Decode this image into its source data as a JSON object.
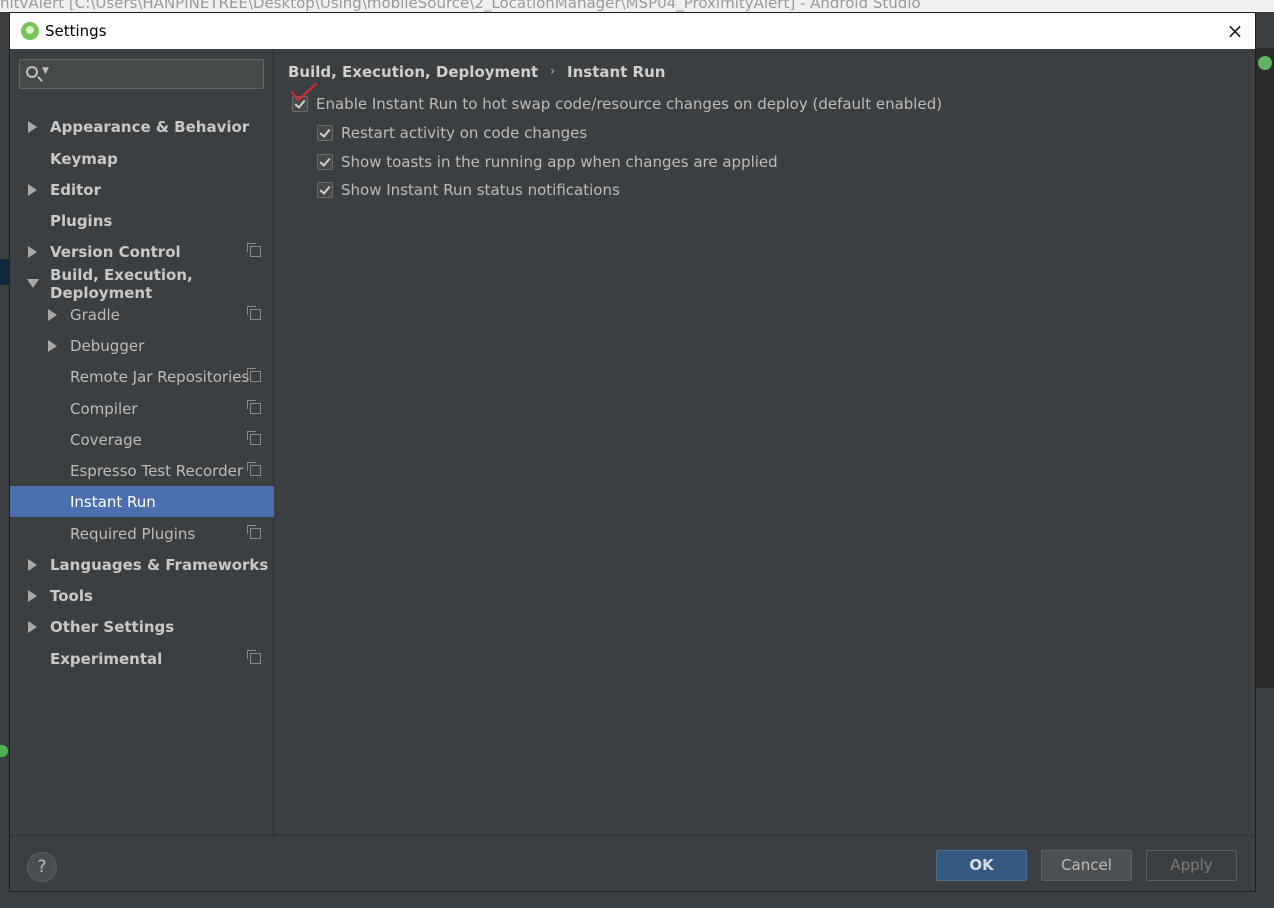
{
  "background": {
    "window_title": "nitvAlert [C:\\Users\\HANPINETREE\\Desktop\\Using\\mobileSource\\2_LocationManager\\MSP04_ProximityAlert] - Android Studio"
  },
  "dialog": {
    "title": "Settings",
    "close_icon": "×"
  },
  "search": {
    "placeholder": ""
  },
  "sidebar": {
    "items": [
      {
        "label": "Appearance & Behavior"
      },
      {
        "label": "Keymap"
      },
      {
        "label": "Editor"
      },
      {
        "label": "Plugins"
      },
      {
        "label": "Version Control"
      },
      {
        "label": "Build, Execution, Deployment"
      },
      {
        "label": "Gradle"
      },
      {
        "label": "Debugger"
      },
      {
        "label": "Remote Jar Repositories"
      },
      {
        "label": "Compiler"
      },
      {
        "label": "Coverage"
      },
      {
        "label": "Espresso Test Recorder"
      },
      {
        "label": "Instant Run"
      },
      {
        "label": "Required Plugins"
      },
      {
        "label": "Languages & Frameworks"
      },
      {
        "label": "Tools"
      },
      {
        "label": "Other Settings"
      },
      {
        "label": "Experimental"
      }
    ]
  },
  "content": {
    "breadcrumb": {
      "parent": "Build, Execution, Deployment",
      "separator": "›",
      "current": "Instant Run"
    },
    "options": [
      {
        "label": "Enable Instant Run to hot swap code/resource changes on deploy (default enabled)",
        "checked": true
      },
      {
        "label": "Restart activity on code changes",
        "checked": true
      },
      {
        "label": "Show toasts in the running app when changes are applied",
        "checked": true
      },
      {
        "label": "Show Instant Run status notifications",
        "checked": true
      }
    ]
  },
  "footer": {
    "help_label": "?",
    "ok_label": "OK",
    "cancel_label": "Cancel",
    "apply_label": "Apply"
  },
  "colors": {
    "dialog_bg": "#3c3f41",
    "selection": "#4b6eaf",
    "ok_button": "#365880",
    "annotation_mark": "#e0262e"
  }
}
